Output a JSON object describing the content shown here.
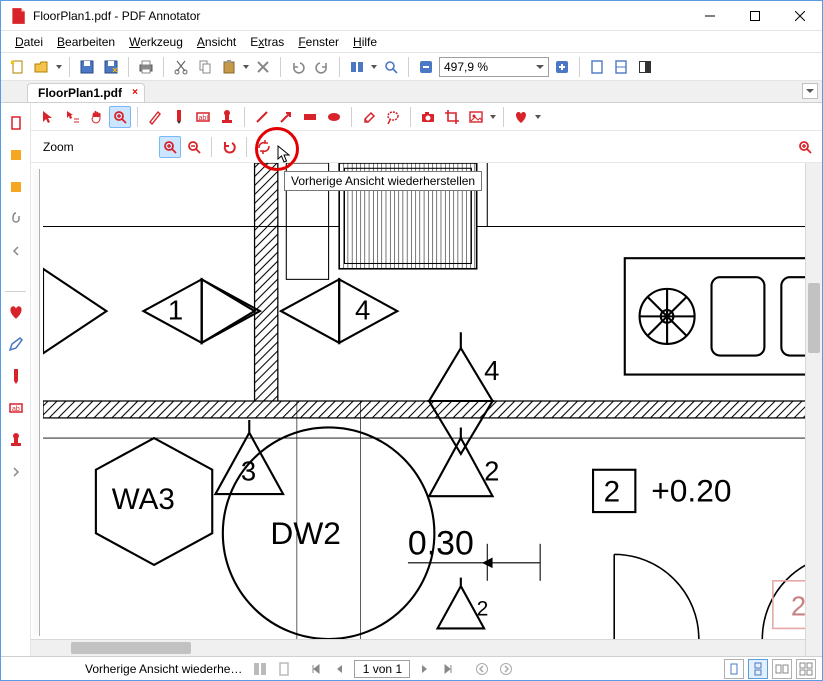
{
  "window": {
    "title": "FloorPlan1.pdf - PDF Annotator"
  },
  "menu": {
    "file": "Datei",
    "edit": "Bearbeiten",
    "tool": "Werkzeug",
    "view": "Ansicht",
    "extras": "Extras",
    "window": "Fenster",
    "help": "Hilfe"
  },
  "toolbar": {
    "zoom_value": "497,9 %"
  },
  "tab": {
    "label": "FloorPlan1.pdf"
  },
  "subtoolbar": {
    "label": "Zoom",
    "tooltip": "Vorherige Ansicht wiederherstellen"
  },
  "drawing": {
    "labels": [
      "1",
      "4",
      "4",
      "2",
      "2",
      "2",
      "2"
    ],
    "wa3": "WA3",
    "dw2": "DW2",
    "dim1": "0.30",
    "dim2": "+0.20",
    "dim2_prefix": "2"
  },
  "status": {
    "text": "Vorherige Ansicht wiederhe…",
    "page": "1 von 1"
  }
}
